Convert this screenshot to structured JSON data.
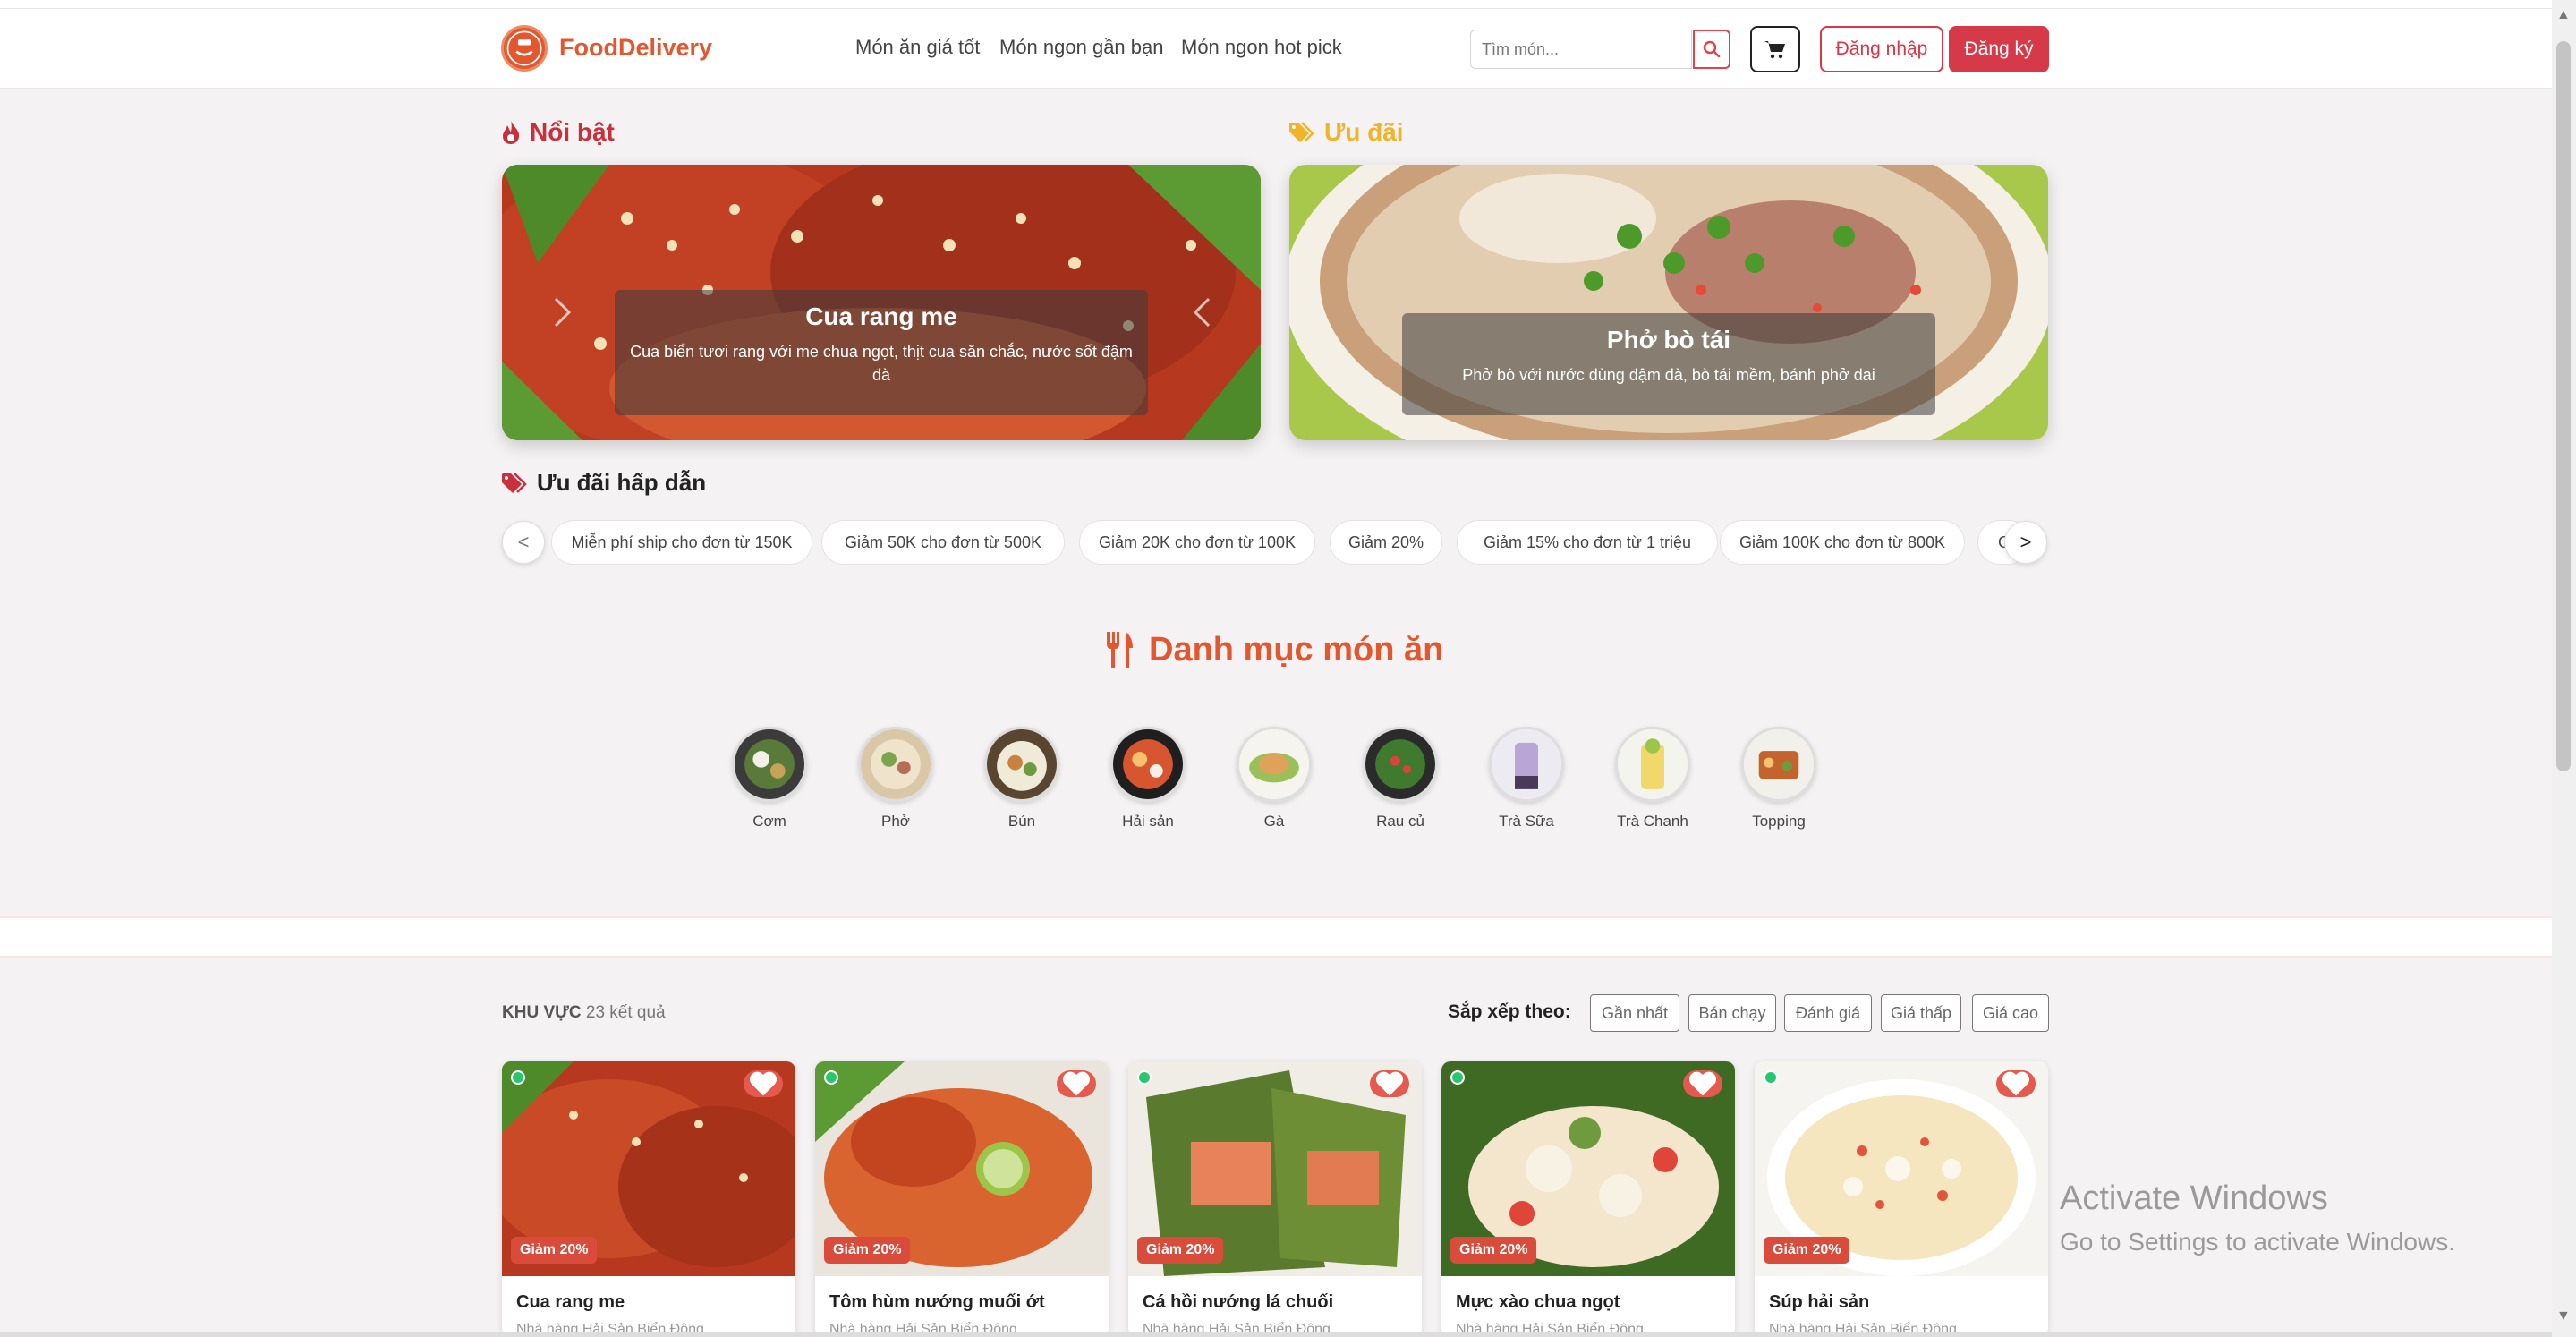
{
  "header": {
    "brand": "FoodDelivery",
    "nav": [
      "Món ăn giá tốt",
      "Món ngon gần bạn",
      "Món ngon hot pick"
    ],
    "search_placeholder": "Tìm món...",
    "login_label": "Đăng nhập",
    "signup_label": "Đăng ký"
  },
  "featured": {
    "title": "Nổi bật",
    "slide_title": "Cua rang me",
    "slide_desc": "Cua biển tươi rang với me chua ngọt, thịt cua săn chắc, nước sốt đậm đà"
  },
  "offer": {
    "title": "Ưu đãi",
    "slide_title": "Phở bò tái",
    "slide_desc": "Phở bò với nước dùng đậm đà, bò tái mềm, bánh phở dai"
  },
  "promos": {
    "title": "Ưu đãi hấp dẫn",
    "prev": "<",
    "next": ">",
    "items": [
      "Miễn phí ship cho đơn từ 150K",
      "Giảm 50K cho đơn từ 500K",
      "Giảm 20K cho đơn từ 100K",
      "Giảm 20%",
      "Giảm 15% cho đơn từ 1 triệu",
      "Giảm 100K cho đơn từ 800K",
      "G"
    ]
  },
  "categories": {
    "title": "Danh mục món ăn",
    "items": [
      "Cơm",
      "Phở",
      "Bún",
      "Hải sản",
      "Gà",
      "Rau củ",
      "Trà Sữa",
      "Trà Chanh",
      "Topping"
    ]
  },
  "results": {
    "region_label": "KHU VỰC",
    "count_text": "23 kết quả",
    "sort_label": "Sắp xếp theo:",
    "sort_options": [
      "Gần nhất",
      "Bán chạy",
      "Đánh giá",
      "Giá thấp",
      "Giá cao"
    ]
  },
  "cards": [
    {
      "name": "Cua rang me",
      "restaurant": "Nhà hàng Hải Sản Biển Đông",
      "discount": "Giảm 20%"
    },
    {
      "name": "Tôm hùm nướng muối ớt",
      "restaurant": "Nhà hàng Hải Sản Biển Đông",
      "discount": "Giảm 20%"
    },
    {
      "name": "Cá hồi nướng lá chuối",
      "restaurant": "Nhà hàng Hải Sản Biển Đông",
      "discount": "Giảm 20%"
    },
    {
      "name": "Mực xào chua ngọt",
      "restaurant": "Nhà hàng Hải Sản Biển Đông",
      "discount": "Giảm 20%"
    },
    {
      "name": "Súp hải sản",
      "restaurant": "Nhà hàng Hải Sản Biển Đông",
      "discount": "Giảm 20%"
    }
  ],
  "watermark": {
    "title": "Activate Windows",
    "subtitle": "Go to Settings to activate Windows."
  },
  "colors": {
    "brand": "#e4572e",
    "primary_red": "#d63a48",
    "gold": "#f0b42a",
    "page_bg": "#f4f2f2"
  }
}
